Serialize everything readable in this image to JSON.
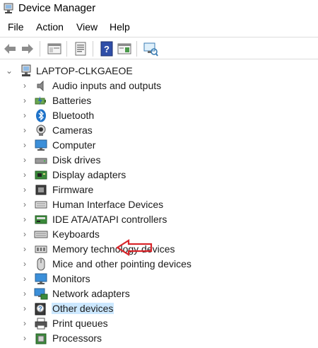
{
  "window": {
    "title": "Device Manager"
  },
  "menu": [
    "File",
    "Action",
    "View",
    "Help"
  ],
  "tree": {
    "root": "LAPTOP-CLKGAEOE",
    "items": [
      {
        "label": "Audio inputs and outputs",
        "icon": "speaker-icon"
      },
      {
        "label": "Batteries",
        "icon": "battery-icon"
      },
      {
        "label": "Bluetooth",
        "icon": "bluetooth-icon"
      },
      {
        "label": "Cameras",
        "icon": "camera-icon"
      },
      {
        "label": "Computer",
        "icon": "computer-icon"
      },
      {
        "label": "Disk drives",
        "icon": "disk-drive-icon"
      },
      {
        "label": "Display adapters",
        "icon": "display-adapter-icon"
      },
      {
        "label": "Firmware",
        "icon": "firmware-icon"
      },
      {
        "label": "Human Interface Devices",
        "icon": "hid-icon"
      },
      {
        "label": "IDE ATA/ATAPI controllers",
        "icon": "ide-controller-icon"
      },
      {
        "label": "Keyboards",
        "icon": "keyboard-icon"
      },
      {
        "label": "Memory technology devices",
        "icon": "memory-icon"
      },
      {
        "label": "Mice and other pointing devices",
        "icon": "mouse-icon"
      },
      {
        "label": "Monitors",
        "icon": "monitor-icon"
      },
      {
        "label": "Network adapters",
        "icon": "network-adapter-icon"
      },
      {
        "label": "Other devices",
        "icon": "unknown-device-icon",
        "selected": true
      },
      {
        "label": "Print queues",
        "icon": "printer-icon"
      },
      {
        "label": "Processors",
        "icon": "processor-icon"
      }
    ]
  },
  "colors": {
    "selection": "#cce8ff",
    "annotation_arrow": "#d9262b"
  }
}
